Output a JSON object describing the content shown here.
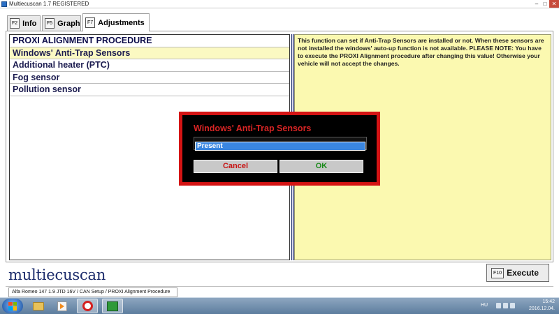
{
  "window": {
    "title": "Multiecuscan 1.7 REGISTERED"
  },
  "tabs": [
    {
      "key": "F2",
      "label": "Info"
    },
    {
      "key": "F5",
      "label": "Graph"
    },
    {
      "key": "F7",
      "label": "Adjustments"
    }
  ],
  "list": {
    "items": [
      "PROXI ALIGNMENT PROCEDURE",
      "Windows' Anti-Trap Sensors",
      "Additional heater (PTC)",
      "Fog sensor",
      "Pollution sensor"
    ]
  },
  "description": "This function can set if Anti-Trap Sensors are installed or not. When these sensors are not installed the windows' auto-up function is not available. PLEASE NOTE: You have to execute the PROXI Alignment procedure after changing this value! Otherwise your vehicle will not accept the changes.",
  "dialog": {
    "title": "Windows' Anti-Trap Sensors",
    "value": "Present",
    "cancel_label": "Cancel",
    "ok_label": "OK"
  },
  "logo": "multiecuscan",
  "execute": {
    "key": "F10",
    "label": "Execute"
  },
  "status": "Alfa Romeo 147 1.9 JTD 16V / CAN Setup / PROXI Alignment Procedure",
  "taskbar": {
    "lang": "HU",
    "time": "15:42",
    "date": "2016.12.04."
  },
  "colors": {
    "list_text": "#1b1b4f",
    "selected_bg": "#fbf9c2",
    "description_bg": "#fbf9b0",
    "dialog_border": "#d41414",
    "dialog_title": "#d82424",
    "cancel_text": "#c81414",
    "ok_text": "#1a8a1a",
    "input_bg": "#3a86e0"
  },
  "icons": {
    "taskbar": [
      "windows-start-icon",
      "folder-icon",
      "media-player-icon",
      "opera-icon",
      "multiecuscan-icon"
    ]
  }
}
